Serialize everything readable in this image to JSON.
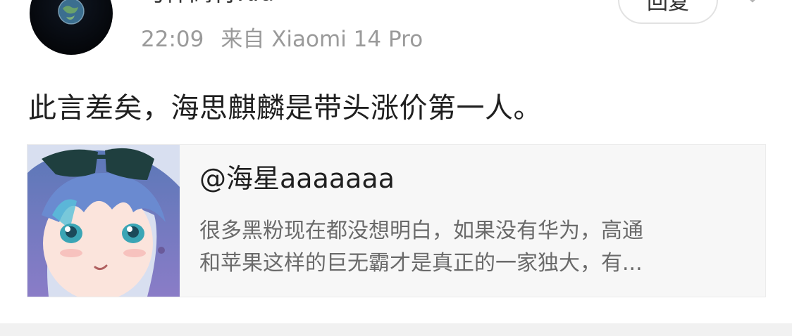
{
  "post": {
    "username": "马棒高背Kid",
    "time": "22:09",
    "source": "来自 Xiaomi 14 Pro",
    "reply_label": "回复",
    "text": "此言差矣，海思麒麟是带头涨价第一人。"
  },
  "quote": {
    "author": "@海星aaaaaaa",
    "line1": "很多黑粉现在都没想明白，如果没有华为，高通",
    "line2": "和苹果这样的巨无霸才是真正的一家独大，有..."
  },
  "icons": {
    "avatar": "planet-avatar",
    "more": "chevron-down-icon",
    "quote_thumb": "anime-girl-avatar"
  },
  "colors": {
    "text_primary": "#1f1f1f",
    "text_secondary": "#9a9a9a",
    "card_bg": "#f7f7f7"
  }
}
